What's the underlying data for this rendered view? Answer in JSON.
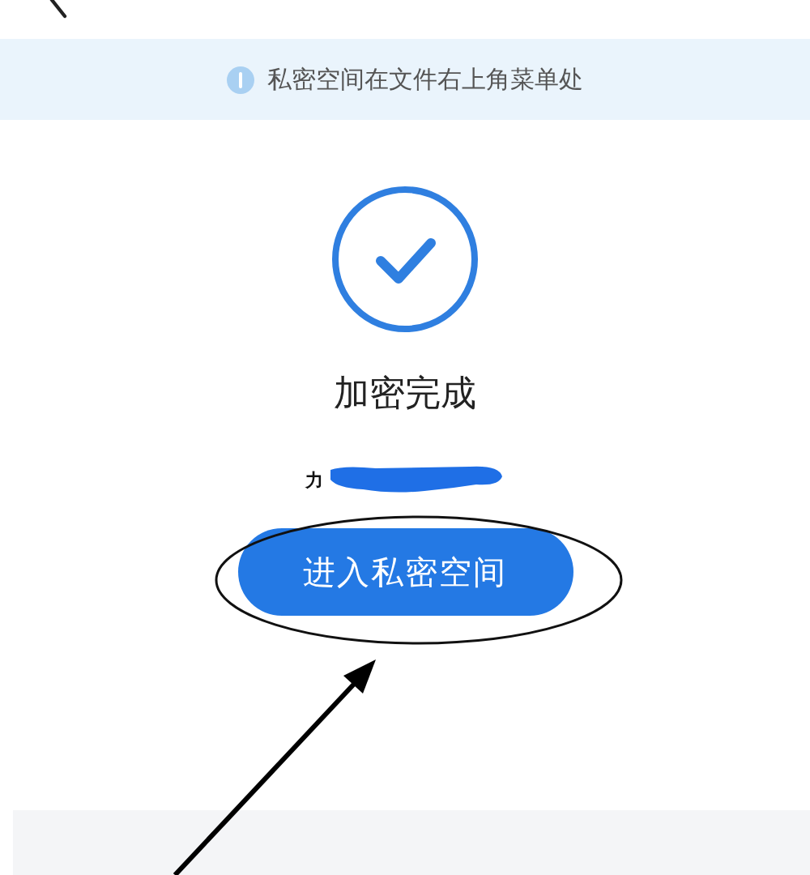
{
  "notice": {
    "text": "私密空间在文件右上角菜单处"
  },
  "result": {
    "title": "加密完成",
    "detail": "力"
  },
  "buttons": [
    {
      "label": "进入私密空间"
    }
  ]
}
